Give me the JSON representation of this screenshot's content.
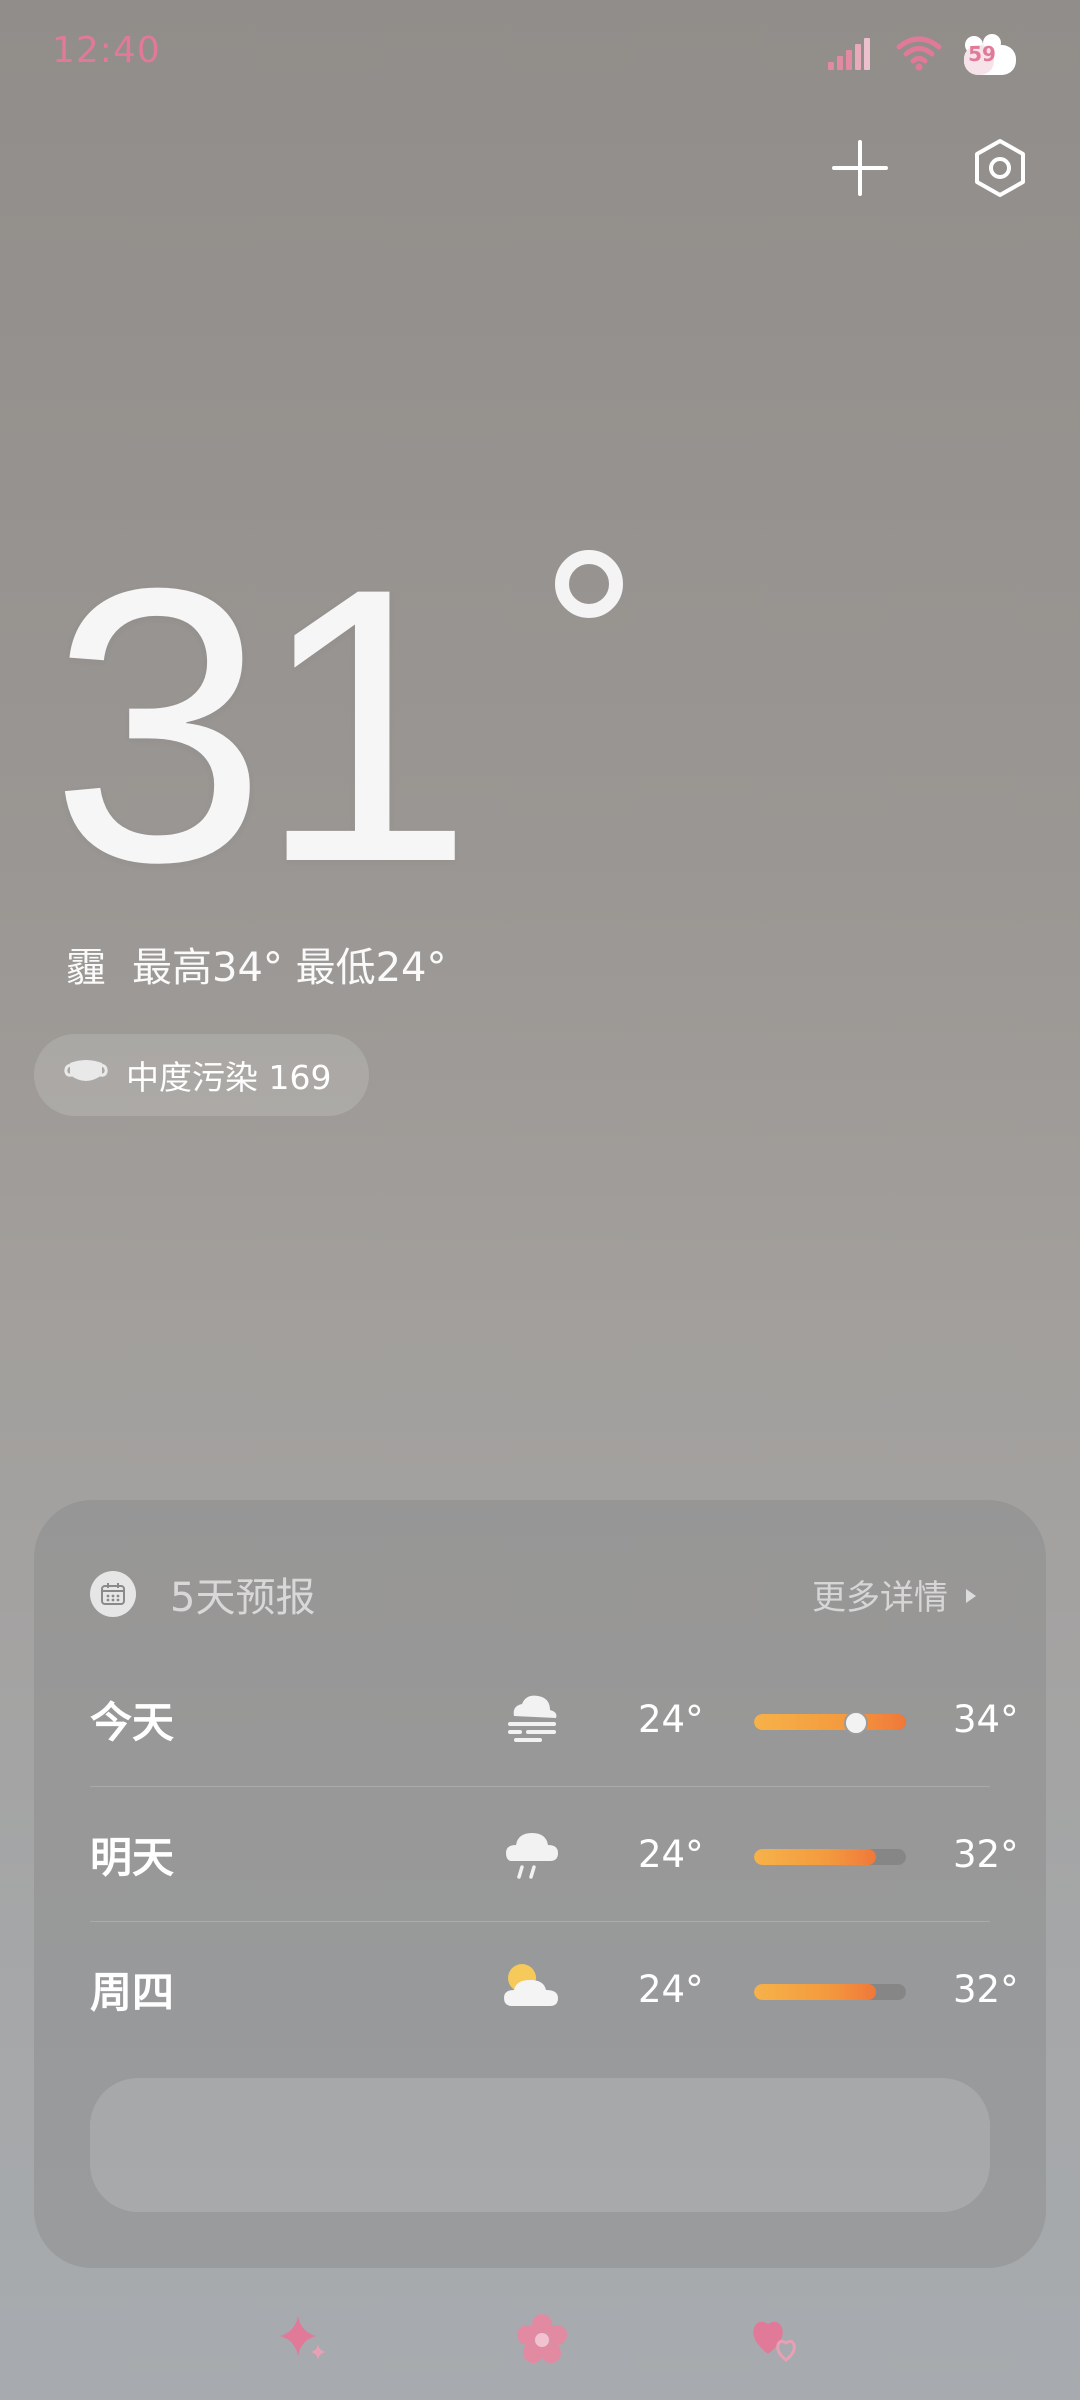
{
  "status_bar": {
    "time": "12:40",
    "battery": "59",
    "accent_color": "#e07a98"
  },
  "top_actions": {
    "add_icon": "plus-icon",
    "settings_icon": "hexagon-gear-icon"
  },
  "current": {
    "temperature": "31",
    "condition": "霾",
    "high_low": "最高34° 最低24°",
    "aqi_label": "中度污染 169"
  },
  "forecast": {
    "title": "5天预报",
    "more": "更多详情",
    "days": [
      {
        "day": "今天",
        "icon": "haze-cloud-icon",
        "low": "24°",
        "high": "34°",
        "bar_fill": 1.0,
        "current_marker": 0.67
      },
      {
        "day": "明天",
        "icon": "rain-cloud-icon",
        "low": "24°",
        "high": "32°",
        "bar_fill": 0.8
      },
      {
        "day": "周四",
        "icon": "partly-cloudy-icon",
        "low": "24°",
        "high": "32°",
        "bar_fill": 0.8
      }
    ]
  },
  "pager": {
    "icons": [
      "sparkle-icon",
      "flower-icon",
      "hearts-icon"
    ]
  }
}
